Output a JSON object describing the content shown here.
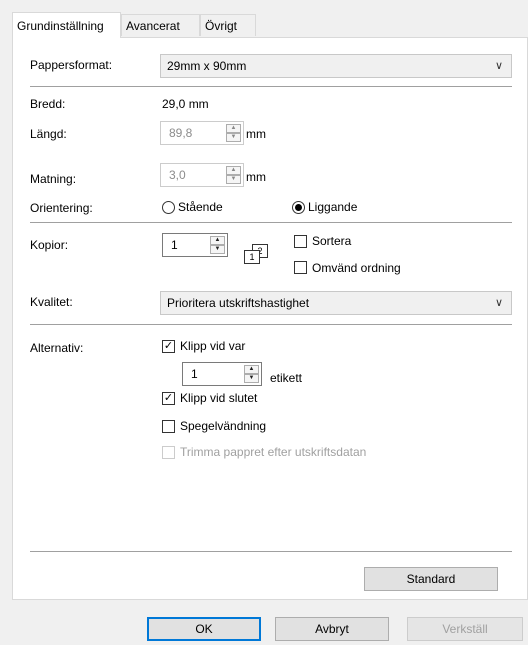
{
  "tabs": [
    {
      "label": "Grundinställning"
    },
    {
      "label": "Avancerat"
    },
    {
      "label": "Övrigt"
    }
  ],
  "paper": {
    "label": "Pappersformat:",
    "value": "29mm x 90mm",
    "width_label": "Bredd:",
    "width_value": "29,0 mm",
    "length_label": "Längd:",
    "length_value": "89,8",
    "length_unit": "mm",
    "feed_label": "Matning:",
    "feed_value": "3,0",
    "feed_unit": "mm"
  },
  "orientation": {
    "label": "Orientering:",
    "portrait": "Stående",
    "landscape": "Liggande",
    "selected": "landscape"
  },
  "copies": {
    "label": "Kopior:",
    "value": "1",
    "collate_icon_1": "1",
    "collate_icon_2": "2",
    "sort_label": "Sortera",
    "reverse_label": "Omvänd ordning"
  },
  "quality": {
    "label": "Kvalitet:",
    "value": "Prioritera utskriftshastighet"
  },
  "options": {
    "label": "Alternativ:",
    "cut_every_label": "Klipp vid var",
    "cut_every_value": "1",
    "label_unit": "etikett",
    "cut_at_end_label": "Klipp vid slutet",
    "mirror_label": "Spegelvändning",
    "trim_label": "Trimma pappret efter utskriftsdatan"
  },
  "standard_button": "Standard",
  "footer": {
    "ok": "OK",
    "cancel": "Avbryt",
    "apply": "Verkställ"
  }
}
